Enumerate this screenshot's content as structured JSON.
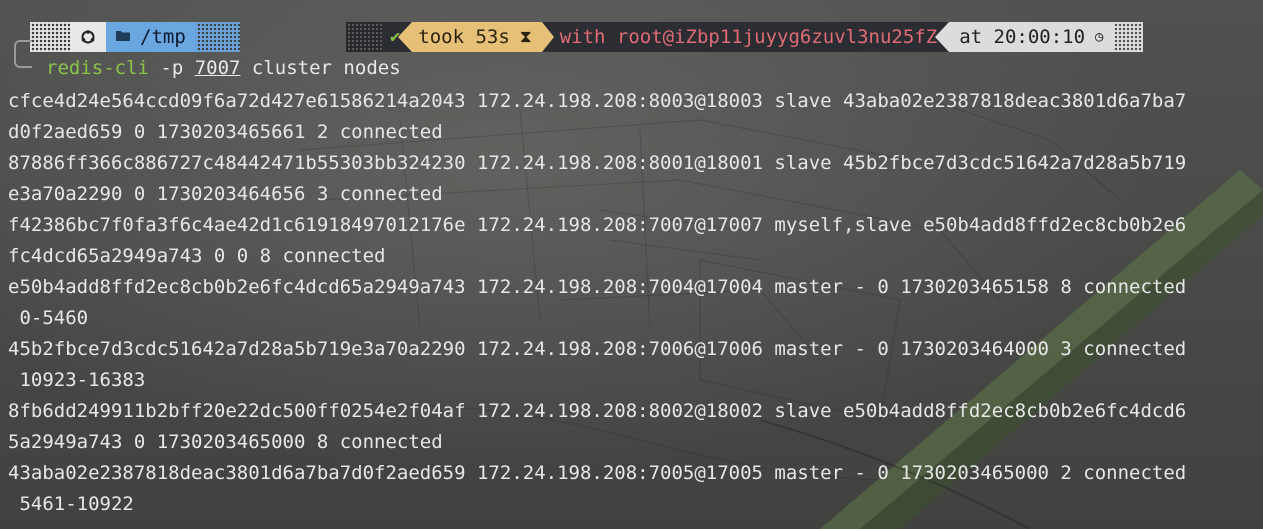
{
  "prompt": {
    "os_icon": "linux-icon",
    "folder_icon": "folder-icon",
    "cwd": "/tmp",
    "status_icon": "check-icon",
    "status_symbol": "✔",
    "took": "took 53s",
    "hourglass_symbol": "⧗",
    "user_host": "with root@iZbp11juyyg6zuvl3nu25fZ",
    "time": "at 20:00:10",
    "clock_symbol": "◷"
  },
  "command": {
    "program": "redis-cli",
    "flag": " -p ",
    "port": "7007",
    "args": " cluster nodes"
  },
  "output_lines": [
    "cfce4d24e564ccd09f6a72d427e61586214a2043 172.24.198.208:8003@18003 slave 43aba02e2387818deac3801d6a7ba7",
    "d0f2aed659 0 1730203465661 2 connected",
    "87886ff366c886727c48442471b55303bb324230 172.24.198.208:8001@18001 slave 45b2fbce7d3cdc51642a7d28a5b719",
    "e3a70a2290 0 1730203464656 3 connected",
    "f42386bc7f0fa3f6c4ae42d1c61918497012176e 172.24.198.208:7007@17007 myself,slave e50b4add8ffd2ec8cb0b2e6",
    "fc4dcd65a2949a743 0 0 8 connected",
    "e50b4add8ffd2ec8cb0b2e6fc4dcd65a2949a743 172.24.198.208:7004@17004 master - 0 1730203465158 8 connected",
    " 0-5460",
    "45b2fbce7d3cdc51642a7d28a5b719e3a70a2290 172.24.198.208:7006@17006 master - 0 1730203464000 3 connected",
    " 10923-16383",
    "8fb6dd249911b2bff20e22dc500ff0254e2f04af 172.24.198.208:8002@18002 slave e50b4add8ffd2ec8cb0b2e6fc4dcd6",
    "5a2949a743 0 1730203465000 8 connected",
    "43aba02e2387818deac3801d6a7ba7d0f2aed659 172.24.198.208:7005@17005 master - 0 1730203465000 2 connected",
    " 5461-10922"
  ]
}
